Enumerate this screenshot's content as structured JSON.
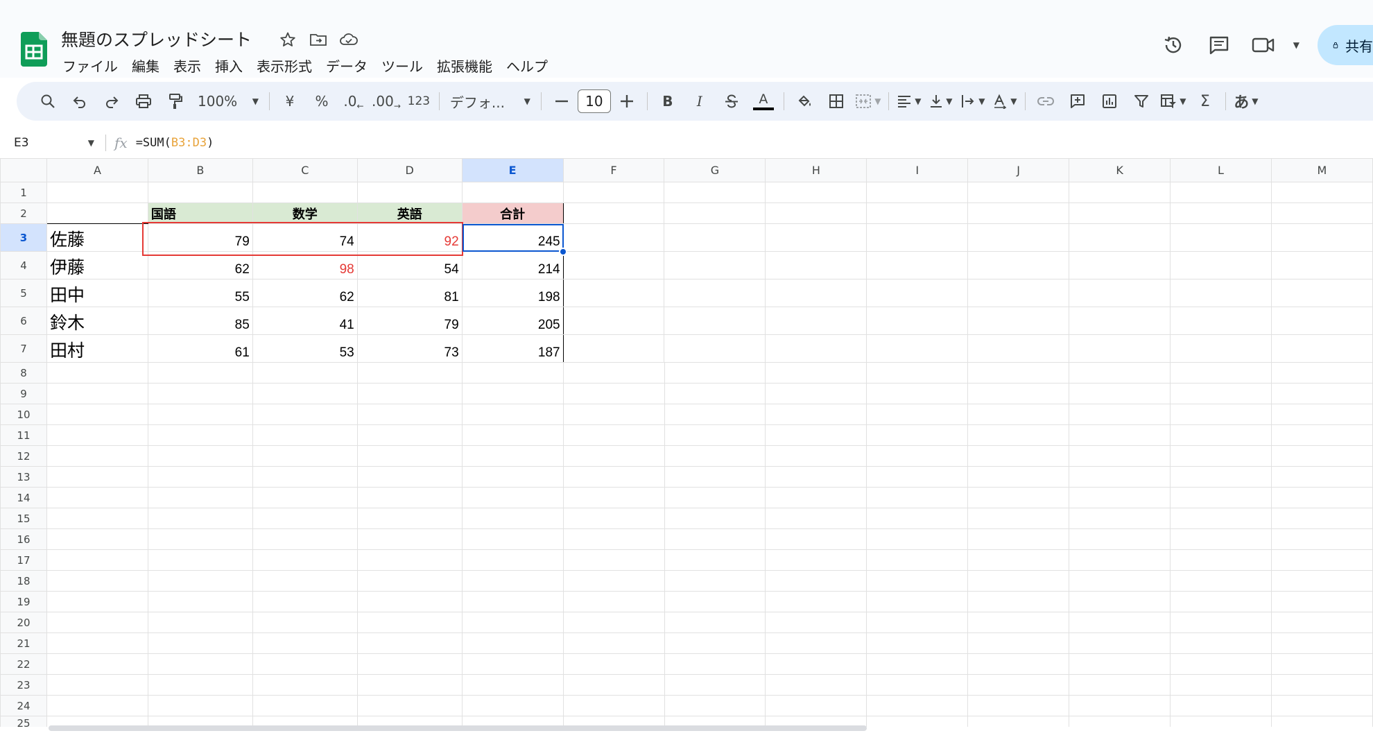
{
  "header": {
    "title": "無題のスプレッドシート",
    "menu": [
      "ファイル",
      "編集",
      "表示",
      "挿入",
      "表示形式",
      "データ",
      "ツール",
      "拡張機能",
      "ヘルプ"
    ],
    "title_icons": [
      "star-icon",
      "move-folder-icon",
      "cloud-status-icon"
    ],
    "right_icons": [
      "history-icon",
      "comment-icon",
      "meet-icon"
    ],
    "share_label": "共有"
  },
  "toolbar": {
    "zoom": "100%",
    "currency": "¥",
    "percent": "%",
    "dec_decrease": ".0",
    "dec_increase": ".00",
    "number_format": "123",
    "font": "デフォ...",
    "font_size": "10",
    "bold": "B",
    "italic": "I",
    "text_color_letter": "A",
    "sigma": "Σ",
    "input_tool": "あ"
  },
  "formula_bar": {
    "name_box": "E3",
    "fx": "fx",
    "formula_prefix": "=SUM(",
    "formula_ref": "B3:D3",
    "formula_suffix": ")"
  },
  "grid": {
    "columns": [
      "A",
      "B",
      "C",
      "D",
      "E",
      "F",
      "G",
      "H",
      "I",
      "J",
      "K",
      "L",
      "M"
    ],
    "selected_column": "E",
    "selected_row": 3,
    "rows": [
      "1",
      "2",
      "3",
      "4",
      "5",
      "6",
      "7",
      "8",
      "9",
      "10",
      "11",
      "12",
      "13",
      "14",
      "15",
      "16",
      "17",
      "18",
      "19",
      "20",
      "21",
      "22",
      "23",
      "24",
      "25"
    ],
    "headers": [
      "国語",
      "数学",
      "英語",
      "合計"
    ],
    "students": [
      {
        "name": "佐藤",
        "values": [
          "79",
          "74",
          "92",
          "245"
        ]
      },
      {
        "name": "伊藤",
        "values": [
          "62",
          "98",
          "54",
          "214"
        ]
      },
      {
        "name": "田中",
        "values": [
          "55",
          "62",
          "81",
          "198"
        ]
      },
      {
        "name": "鈴木",
        "values": [
          "85",
          "41",
          "79",
          "205"
        ]
      },
      {
        "name": "田村",
        "values": [
          "61",
          "53",
          "73",
          "187"
        ]
      }
    ]
  },
  "colors": {
    "header_green": "#d9ead3",
    "header_pink": "#f4cccc",
    "highlight_red": "#e53935",
    "selection_blue": "#0b57d0",
    "sheets_green": "#0f9d58"
  }
}
